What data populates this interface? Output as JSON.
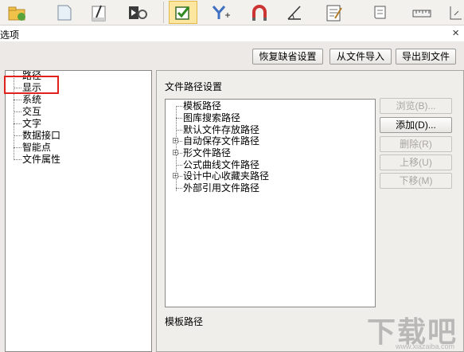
{
  "toolbar": {
    "icons": [
      "folder-open-icon",
      "new-document-icon",
      "text-style-icon",
      "layer-settings-icon",
      "checkbox-options-icon",
      "snap-filter-icon",
      "magnet-icon",
      "angle-tool-icon",
      "notes-edit-icon",
      "scroll-icon",
      "ruler-icon",
      "dimension-icon"
    ],
    "active_index": 4
  },
  "window": {
    "title": "选项",
    "close_glyph": "×"
  },
  "header_buttons": {
    "restore_defaults": "恢复缺省设置",
    "import_from_file": "从文件导入",
    "export_to_file": "导出到文件"
  },
  "nav": {
    "items": [
      "路径",
      "显示",
      "系统",
      "交互",
      "文字",
      "数据接口",
      "智能点",
      "文件属性"
    ],
    "highlighted": "显示"
  },
  "file_paths": {
    "group_label": "文件路径设置",
    "items": [
      {
        "label": "模板路径",
        "expandable": false
      },
      {
        "label": "图库搜索路径",
        "expandable": false
      },
      {
        "label": "默认文件存放路径",
        "expandable": false
      },
      {
        "label": "自动保存文件路径",
        "expandable": true
      },
      {
        "label": "形文件路径",
        "expandable": true
      },
      {
        "label": "公式曲线文件路径",
        "expandable": false
      },
      {
        "label": "设计中心收藏夹路径",
        "expandable": true
      },
      {
        "label": "外部引用文件路径",
        "expandable": false
      }
    ],
    "expander_glyph": "+",
    "selected_caption": "模板路径"
  },
  "side_buttons": {
    "browse": "浏览(B)...",
    "add": "添加(D)...",
    "delete": "删除(R)",
    "move_up": "上移(U)",
    "move_down": "下移(M)"
  },
  "watermark": {
    "logo": "下载吧",
    "url": "www.xiazaiba.com"
  },
  "colors": {
    "highlight_border": "#e0221d",
    "active_toolbar": "#fde6a0"
  }
}
